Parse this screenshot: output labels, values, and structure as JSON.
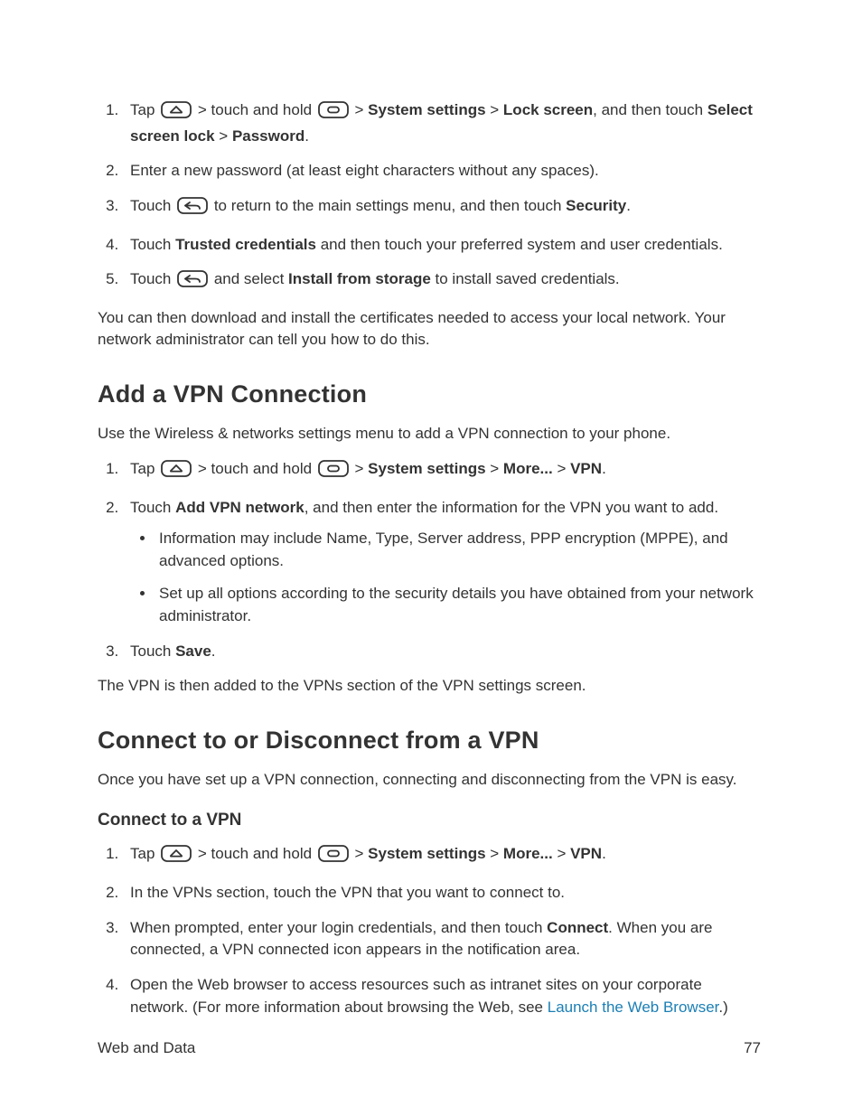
{
  "listA": {
    "item1": {
      "pre": "Tap ",
      "mid1": " > touch and hold ",
      "mid2": " > ",
      "b1": "System settings",
      "sep1": " > ",
      "b2": "Lock screen",
      "post1": ", and then touch ",
      "b3": "Select screen lock",
      "sep2": " > ",
      "b4": "Password",
      "end": "."
    },
    "item2": "Enter a new password (at least eight characters without any spaces).",
    "item3": {
      "pre": "Touch ",
      "post": " to return to the main settings menu, and then touch ",
      "b1": "Security",
      "end": "."
    },
    "item4": {
      "pre": "Touch ",
      "b1": "Trusted credentials",
      "post": " and then touch your preferred system and user credentials."
    },
    "item5": {
      "pre": "Touch ",
      "mid": " and select ",
      "b1": "Install from storage",
      "post": " to install saved credentials."
    }
  },
  "paraA": "You can then download and install the certificates needed to access your local network. Your network administrator can tell you how to do this.",
  "headingB": "Add a VPN Connection",
  "paraB": "Use the Wireless & networks settings menu to add a VPN connection to your phone.",
  "listB": {
    "item1": {
      "pre": "Tap ",
      "mid1": " > touch and hold ",
      "mid2": " > ",
      "b1": "System settings",
      "sep1": " > ",
      "b2": "More...",
      "sep2": " > ",
      "b3": "VPN",
      "end": "."
    },
    "item2": {
      "pre": "Touch ",
      "b1": "Add VPN network",
      "post": ", and then enter the information for the VPN you want to add."
    },
    "sub1": "Information may include Name, Type, Server address, PPP encryption (MPPE), and advanced options.",
    "sub2": "Set up all options according to the security details you have obtained from your network administrator.",
    "item3": {
      "pre": "Touch ",
      "b1": "Save",
      "end": "."
    }
  },
  "paraC": "The VPN is then added to the VPNs section of the VPN settings screen.",
  "headingC": "Connect to or Disconnect from a VPN",
  "paraD": "Once you have set up a VPN connection, connecting and disconnecting from the VPN is easy.",
  "headingD": "Connect to a VPN",
  "listC": {
    "item1": {
      "pre": "Tap ",
      "mid1": " > touch and hold ",
      "mid2": " > ",
      "b1": "System settings",
      "sep1": " > ",
      "b2": "More...",
      "sep2": " > ",
      "b3": "VPN",
      "end": "."
    },
    "item2": "In the VPNs section, touch the VPN that you want to connect to.",
    "item3": {
      "pre": "When prompted, enter your login credentials, and then touch ",
      "b1": "Connect",
      "post": ". When you are connected, a VPN connected icon appears in the notification area."
    },
    "item4": {
      "pre": "Open the Web browser to access resources such as intranet sites on your corporate network. (For more information about browsing the Web, see ",
      "link": "Launch the Web Browser",
      "post": ".)"
    }
  },
  "footer": {
    "section": "Web and Data",
    "page": "77"
  }
}
